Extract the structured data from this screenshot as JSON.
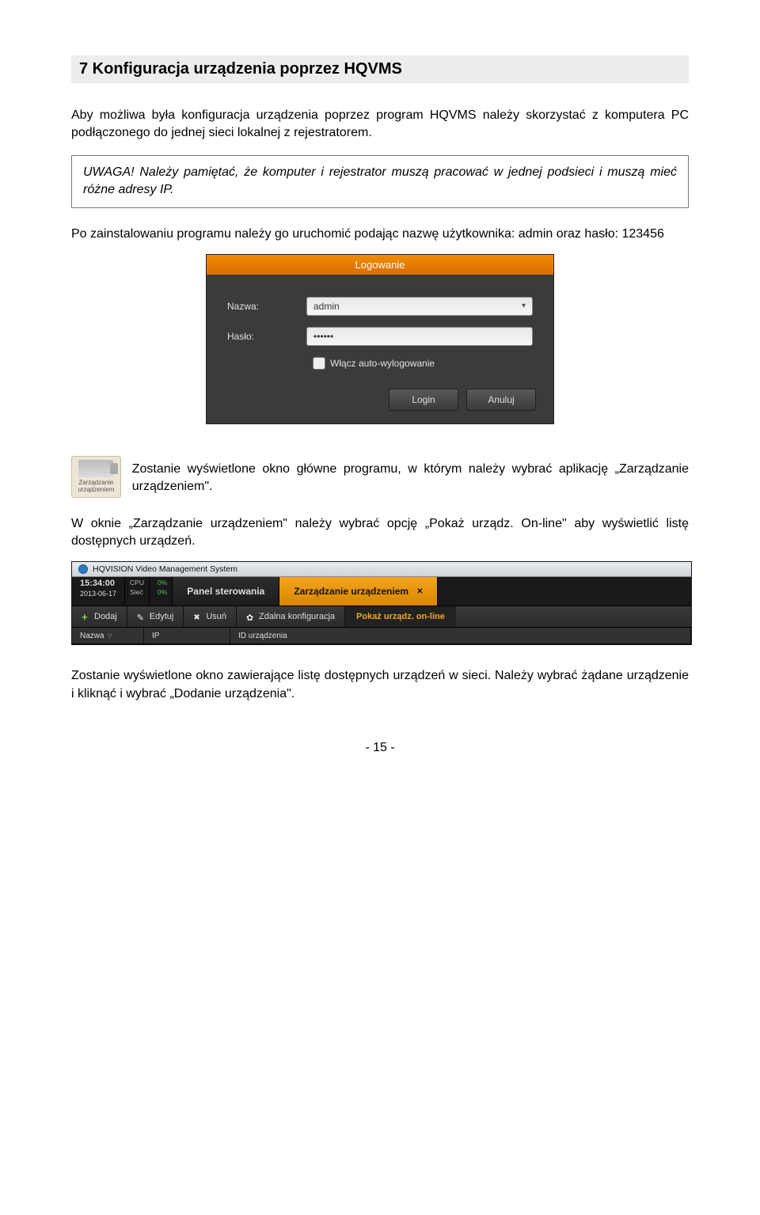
{
  "section_title": "7  Konfiguracja urządzenia poprzez HQVMS",
  "para1": "Aby możliwa była konfiguracja urządzenia poprzez program HQVMS należy skorzystać z komputera PC podłączonego do jednej sieci lokalnej z rejestratorem.",
  "uwaga": "UWAGA! Należy pamiętać, że komputer i rejestrator muszą pracować w jednej podsieci i muszą mieć różne adresy IP.",
  "para2": "Po zainstalowaniu programu należy go uruchomić podając nazwę użytkownika: admin oraz hasło: 123456",
  "login": {
    "title": "Logowanie",
    "name_label": "Nazwa:",
    "name_value": "admin",
    "pass_label": "Hasło:",
    "pass_value": "••••••",
    "autolog_label": "Włącz auto-wylogowanie",
    "login_btn": "Login",
    "cancel_btn": "Anuluj"
  },
  "mgmt_icon_label": "Zarządzanie urządzeniem",
  "para3": "Zostanie wyświetlone okno główne programu, w którym należy wybrać aplikację „Zarządzanie urządzeniem\".",
  "para4": "W oknie „Zarządzanie urządzeniem\" należy wybrać opcję „Pokaż urządz. On-line\" aby wyświetlić listę dostępnych urządzeń.",
  "app": {
    "title": "HQVISION Video Management System",
    "time": "15:34:00",
    "date": "2013-06-17",
    "cpu_label": "CPU",
    "net_label": "Sieć",
    "cpu_val": "0%",
    "net_val": "0%",
    "tab_panel": "Panel sterowania",
    "tab_mgmt": "Zarządzanie urządzeniem",
    "btn_add": "Dodaj",
    "btn_edit": "Edytuj",
    "btn_del": "Usuń",
    "btn_remote": "Zdalna konfiguracja",
    "btn_show": "Pokaż urządz. on-line",
    "col_name": "Nazwa",
    "col_ip": "IP",
    "col_id": "ID urządzenia"
  },
  "para5": "Zostanie wyświetlone okno zawierające listę dostępnych urządzeń w sieci. Należy wybrać żądane urządzenie i kliknąć i wybrać „Dodanie urządzenia\".",
  "page_number": "- 15 -"
}
